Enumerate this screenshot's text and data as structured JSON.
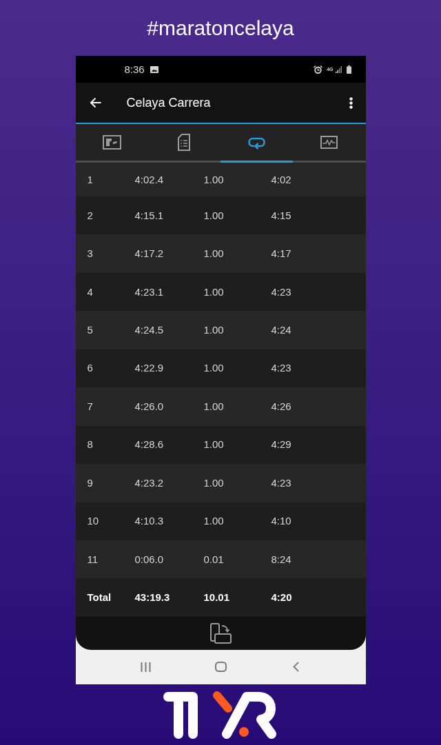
{
  "caption": "#maratoncelaya",
  "status_bar": {
    "time": "8:36",
    "network": "4G"
  },
  "app_bar": {
    "title": "Celaya Carrera"
  },
  "tabs": [
    {
      "kind": "map",
      "selected": false
    },
    {
      "kind": "document",
      "selected": false
    },
    {
      "kind": "laps",
      "selected": true
    },
    {
      "kind": "chart",
      "selected": false
    }
  ],
  "table": {
    "rows": [
      {
        "kind": "lap",
        "cells": [
          "1",
          "4:02.4",
          "1.00",
          "4:02"
        ]
      },
      {
        "kind": "lap",
        "cells": [
          "2",
          "4:15.1",
          "1.00",
          "4:15"
        ]
      },
      {
        "kind": "lap",
        "cells": [
          "3",
          "4:17.2",
          "1.00",
          "4:17"
        ]
      },
      {
        "kind": "lap",
        "cells": [
          "4",
          "4:23.1",
          "1.00",
          "4:23"
        ]
      },
      {
        "kind": "lap",
        "cells": [
          "5",
          "4:24.5",
          "1.00",
          "4:24"
        ]
      },
      {
        "kind": "lap",
        "cells": [
          "6",
          "4:22.9",
          "1.00",
          "4:23"
        ]
      },
      {
        "kind": "lap",
        "cells": [
          "7",
          "4:26.0",
          "1.00",
          "4:26"
        ]
      },
      {
        "kind": "lap",
        "cells": [
          "8",
          "4:28.6",
          "1.00",
          "4:29"
        ]
      },
      {
        "kind": "lap",
        "cells": [
          "9",
          "4:23.2",
          "1.00",
          "4:23"
        ]
      },
      {
        "kind": "lap",
        "cells": [
          "10",
          "4:10.3",
          "1.00",
          "4:10"
        ]
      },
      {
        "kind": "lap",
        "cells": [
          "11",
          "0:06.0",
          "0.01",
          "8:24"
        ]
      },
      {
        "kind": "total",
        "cells": [
          "Total",
          "43:19.3",
          "10.01",
          "4:20"
        ]
      }
    ]
  }
}
